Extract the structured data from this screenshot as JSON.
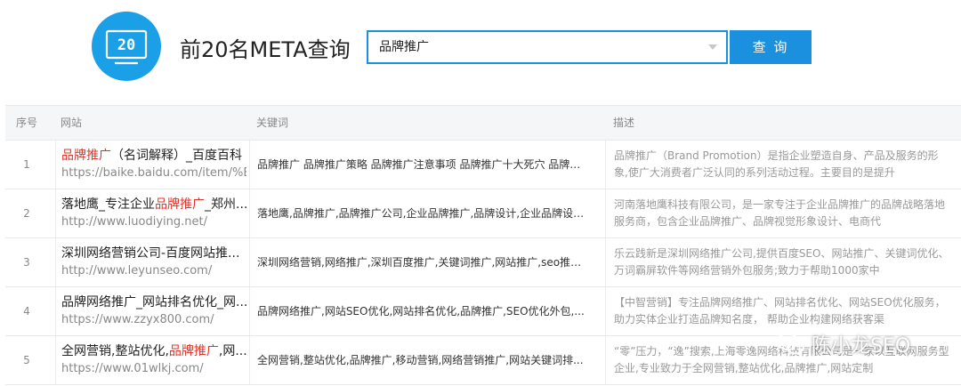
{
  "header": {
    "logo_text": "20",
    "title": "前20名META查询",
    "search_value": "品牌推广",
    "search_button": "查 询"
  },
  "table": {
    "columns": [
      "序号",
      "网站",
      "关键词",
      "描述"
    ],
    "rows": [
      {
        "index": "1",
        "title_parts": [
          {
            "text": "品牌推广",
            "hl": true
          },
          {
            "text": "（名词解释）_百度百科",
            "hl": false
          }
        ],
        "url": "https://baike.baidu.com/item/%E...",
        "keywords": "品牌推广 品牌推广策略 品牌推广注意事项 品牌推广十大死穴 品牌推广的意义",
        "description": "品牌推广（Brand Promotion）是指企业塑造自身、产品及服务的形象,使广大消费者广泛认同的系列活动过程。主要目的是提升"
      },
      {
        "index": "2",
        "title_parts": [
          {
            "text": "落地鹰_专注企业",
            "hl": false
          },
          {
            "text": "品牌推广",
            "hl": true
          },
          {
            "text": "_郑州...",
            "hl": false
          }
        ],
        "url": "http://www.luodiying.net/",
        "keywords": "落地鹰,品牌推广,品牌推广公司,企业品牌推广,品牌设计,企业品牌设计...",
        "description": "河南落地鹰科技有限公司，是一家专注于企业品牌推广的品牌战略落地服务商，包含企业品牌推广、品牌视觉形象设计、电商代"
      },
      {
        "index": "3",
        "title_parts": [
          {
            "text": "深圳网络营销公司-百度网站推...",
            "hl": false
          }
        ],
        "url": "http://www.leyunseo.com/",
        "keywords": "深圳网络营销,网络推广,深圳百度推广,关键词推广,网站推广,seo推广...",
        "description": "乐云践新是深圳网络推广公司,提供百度SEO、网站推广、关键词优化、万词霸屏软件等网络营销外包服务;致力于帮助1000家中"
      },
      {
        "index": "4",
        "title_parts": [
          {
            "text": "品牌网络推广_网站排名优化_网...",
            "hl": false
          }
        ],
        "url": "https://www.zzyx800.com/",
        "keywords": "品牌网络推广,网站SEO优化,网站排名优化,品牌推广,SEO优化外包,...",
        "description": "【中智营销】专注品牌网络推广、网站排名优化、网站SEO优化服务，助力实体企业打造品牌知名度， 帮助企业构建网络获客渠"
      },
      {
        "index": "5",
        "title_parts": [
          {
            "text": "全网营销,整站优化,",
            "hl": false
          },
          {
            "text": "品牌推广",
            "hl": true
          },
          {
            "text": ",网...",
            "hl": false
          }
        ],
        "url": "https://www.01wlkj.com/",
        "keywords": "全网营销,整站优化,品牌推广,移动营销,网络营销推广,网站关键词排...",
        "description": "“零”压力，“逸”搜索,上海零逸网络科技有限公司是一家以互联网服务型企业,专业致力于全网营销,整站优化,品牌推广,网站定制"
      }
    ]
  },
  "watermark": {
    "text": "陈小龙SEO",
    "icon": "wechat-icon"
  },
  "colors": {
    "accent": "#1a90df",
    "logo": "#1ba0e8",
    "highlight": "#e0342b"
  }
}
